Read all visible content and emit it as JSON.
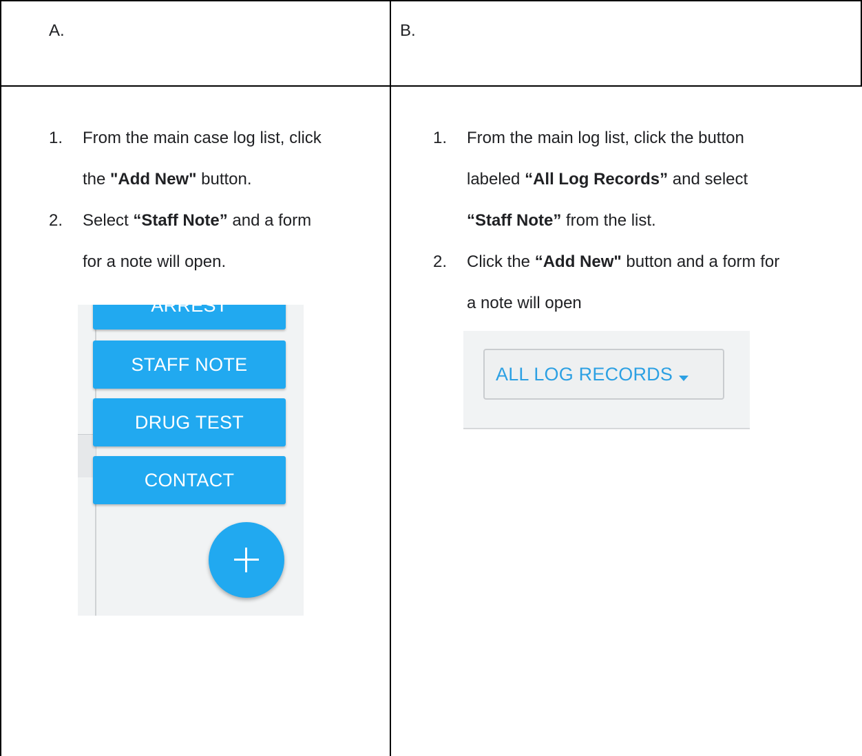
{
  "columns": {
    "a": {
      "label": "A.",
      "steps": [
        {
          "num": "1.",
          "parts": [
            "From the main case log list, click",
            "the ",
            "\"Add New\"",
            " button."
          ]
        },
        {
          "num": "2.",
          "parts": [
            "Select ",
            "“Staff Note”",
            " and a form",
            "for a note will open."
          ]
        }
      ],
      "screenshot": {
        "buttons": [
          "ARREST",
          "STAFF NOTE",
          "DRUG TEST",
          "CONTACT"
        ],
        "fab_icon": "plus-icon"
      }
    },
    "b": {
      "label": "B.",
      "steps": [
        {
          "num": "1.",
          "parts": [
            "From the main log list, click the button",
            "labeled ",
            "“All Log Records”",
            " and select",
            "“Staff Note”",
            " from the list."
          ]
        },
        {
          "num": "2.",
          "parts": [
            "Click the ",
            "“Add New\"",
            " button and a form for",
            "a note will open"
          ]
        }
      ],
      "screenshot": {
        "dropdown_label": "ALL LOG RECORDS",
        "dropdown_icon": "caret-down-icon"
      }
    }
  },
  "colors": {
    "button_blue": "#21a9f0",
    "dropdown_text": "#2ca0e3",
    "screenshot_bg": "#f1f3f4"
  }
}
